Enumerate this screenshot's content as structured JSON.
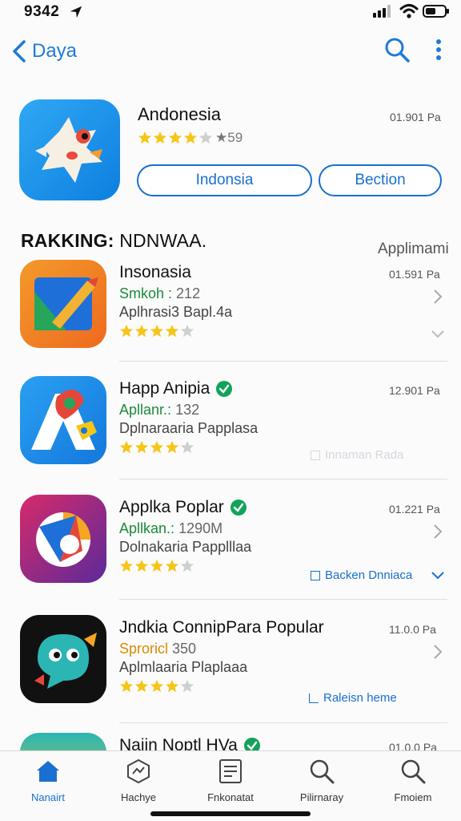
{
  "status_bar": {
    "time": "9342"
  },
  "nav": {
    "back_label": "Daya"
  },
  "featured": {
    "title": "Andonesia",
    "meta": "01.901 Pa",
    "rating_count": "59",
    "rating": 4,
    "button_primary": "Indonsia",
    "button_secondary": "Bection"
  },
  "section": {
    "title_bold": "RAKKING:",
    "title_rest": "NDNWAA.",
    "link": "Applimami"
  },
  "apps": [
    {
      "name": "Insonasia",
      "sub_accent": "Smkoh :",
      "sub_num": "212",
      "desc": "Aplhrasi3 Bapl.4a",
      "size": "01.591 Pa",
      "rating": 4,
      "verified": false,
      "sub_color": "#1a8a3a"
    },
    {
      "name": "Happ Anipia",
      "sub_accent": "Apllanr.:",
      "sub_num": "132",
      "desc": "Dplnaraaria Papplasa",
      "size": "12.901 Pa",
      "rating": 4,
      "verified": true,
      "action": "Innaman Rada",
      "sub_color": "#1a8a3a"
    },
    {
      "name": "Applka Poplar",
      "sub_accent": "Apllkan.:",
      "sub_num": "1290M",
      "desc": "Dolnakaria Papplllaa",
      "size": "01.221 Pa",
      "rating": 4,
      "verified": true,
      "action": "Backen Dnniaca",
      "sub_color": "#1a8a3a"
    },
    {
      "name": "Jndkia ConnipPara Popular",
      "sub_accent": "Sproricl",
      "sub_num": "350",
      "desc": "Aplmlaaria Plaplaaa",
      "size": "11.0.0 Pa",
      "rating": 4,
      "verified": false,
      "action": "Raleisn heme",
      "sub_color": "#d98a00"
    },
    {
      "name": "Najin Noptl HVa",
      "size": "01.0.0 Pa",
      "verified": true
    }
  ],
  "tabs": [
    {
      "label": "Nanairt",
      "icon": "home-icon"
    },
    {
      "label": "Hachye",
      "icon": "shield-chart-icon"
    },
    {
      "label": "Fnkonatat",
      "icon": "document-icon"
    },
    {
      "label": "Pilirnaray",
      "icon": "search-icon"
    },
    {
      "label": "Fmoiem",
      "icon": "search-icon"
    }
  ],
  "colors": {
    "accent": "#1a6fd0",
    "star": "#f5c518",
    "verified": "#12a35a"
  }
}
